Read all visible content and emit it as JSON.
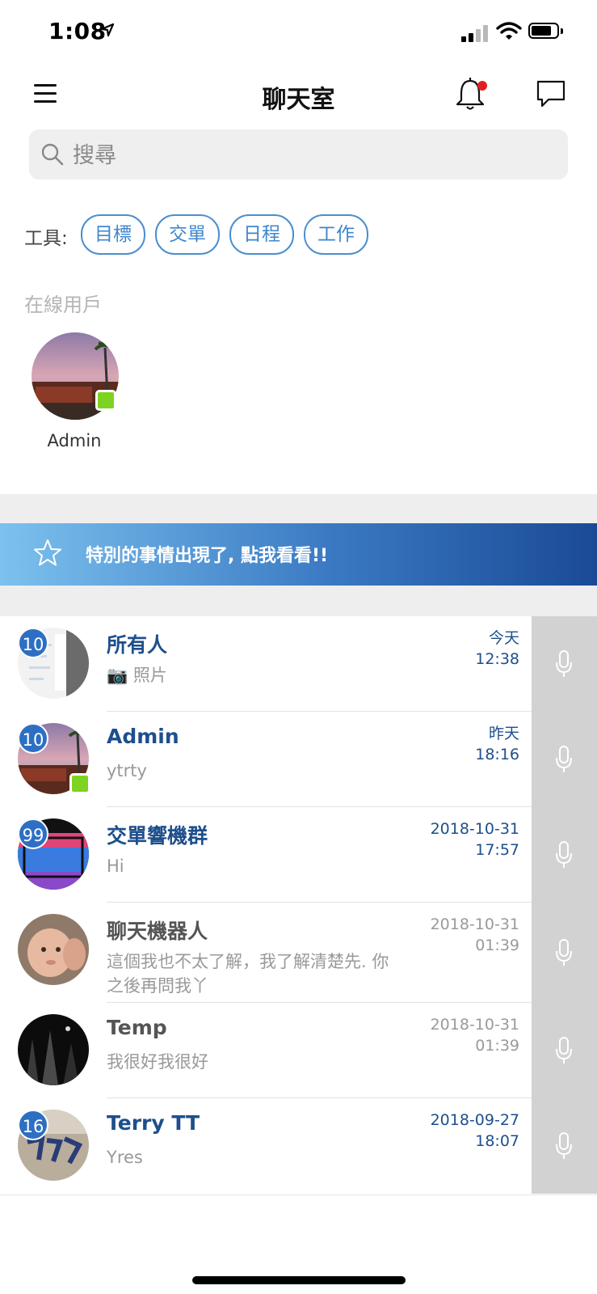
{
  "status_bar": {
    "time": "1:08"
  },
  "nav": {
    "title": "聊天室"
  },
  "search": {
    "placeholder": "搜尋"
  },
  "tools": {
    "label": "工具:",
    "chips": [
      "目標",
      "交單",
      "日程",
      "工作"
    ]
  },
  "online": {
    "heading": "在線用戶",
    "users": [
      {
        "name": "Admin"
      }
    ]
  },
  "banner": {
    "text": "特別的事情出現了, 點我看看!!"
  },
  "chats": [
    {
      "name": "所有人",
      "preview": "📷 照片",
      "date": "今天",
      "time": "12:38",
      "badge": "10",
      "highlight": true
    },
    {
      "name": "Admin",
      "preview": "ytrty",
      "date": "昨天",
      "time": "18:16",
      "badge": "10",
      "highlight": true
    },
    {
      "name": "交單響機群",
      "preview": "Hi",
      "date": "2018-10-31",
      "time": "17:57",
      "badge": "99",
      "highlight": true
    },
    {
      "name": "聊天機器人",
      "preview": "這個我也不太了解，我了解清楚先. 你之後再問我丫",
      "date": "2018-10-31",
      "time": "01:39",
      "badge": "",
      "highlight": false
    },
    {
      "name": "Temp",
      "preview": "我很好我很好",
      "date": "2018-10-31",
      "time": "01:39",
      "badge": "",
      "highlight": false
    },
    {
      "name": "Terry TT",
      "preview": "Yres",
      "date": "2018-09-27",
      "time": "18:07",
      "badge": "16",
      "highlight": true
    }
  ],
  "colors": {
    "accent": "#1e4f8c",
    "chip_border": "#4a8fd0",
    "badge": "#2d6fc2",
    "online": "#7ed321",
    "notification_dot": "#e02020"
  },
  "icons": [
    "menu-icon",
    "bell-icon",
    "chat-bubble-icon",
    "search-icon",
    "star-icon",
    "microphone-icon",
    "camera-icon"
  ]
}
